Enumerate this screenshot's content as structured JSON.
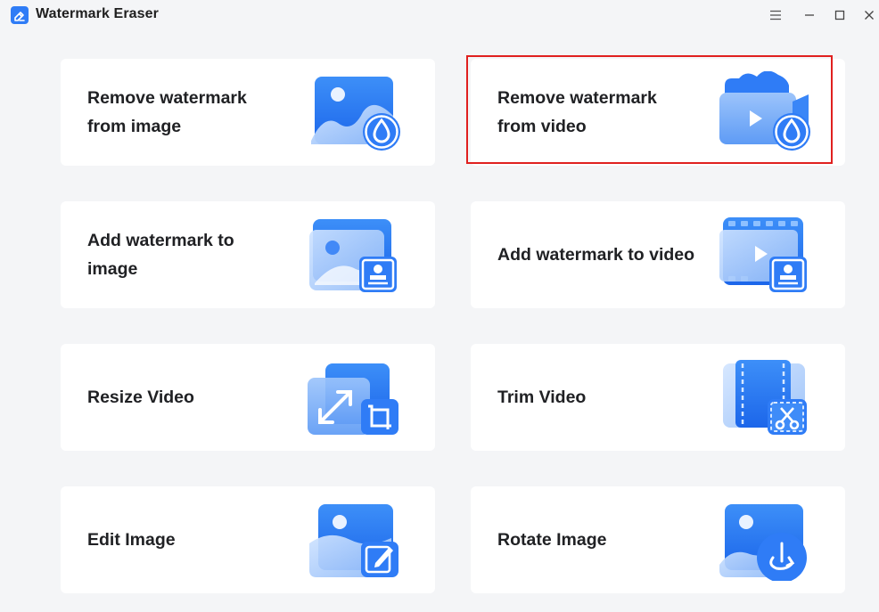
{
  "window": {
    "title": "Watermark Eraser",
    "controls": [
      "menu-icon",
      "minimize-icon",
      "maximize-icon",
      "close-icon"
    ]
  },
  "cards": [
    {
      "id": "remove-watermark-image",
      "label": "Remove watermark from image",
      "icon": "image-droplet-icon"
    },
    {
      "id": "remove-watermark-video",
      "label": "Remove watermark from video",
      "icon": "video-droplet-icon",
      "highlighted": true
    },
    {
      "id": "add-watermark-image",
      "label": "Add watermark to image",
      "icon": "image-stamp-icon"
    },
    {
      "id": "add-watermark-video",
      "label": "Add watermark to video",
      "icon": "video-stamp-icon"
    },
    {
      "id": "resize-video",
      "label": "Resize Video",
      "icon": "resize-crop-icon"
    },
    {
      "id": "trim-video",
      "label": "Trim Video",
      "icon": "film-scissors-icon"
    },
    {
      "id": "edit-image",
      "label": "Edit Image",
      "icon": "image-pencil-icon"
    },
    {
      "id": "rotate-image",
      "label": "Rotate Image",
      "icon": "image-rotate-icon"
    }
  ],
  "colors": {
    "background": "#f4f5f7",
    "card": "#ffffff",
    "accent": "#2f7cf6",
    "highlight_border": "#e0201f"
  }
}
